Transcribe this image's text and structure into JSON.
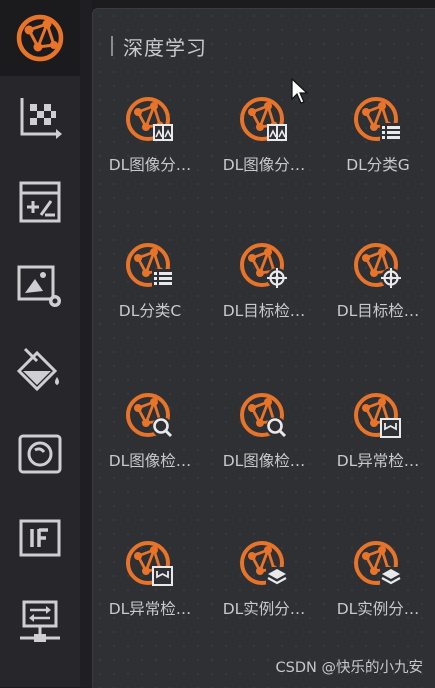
{
  "rail": {
    "items": [
      {
        "name": "deep-learning-icon",
        "active": true
      },
      {
        "name": "scatter-matrix-icon",
        "active": false
      },
      {
        "name": "calculator-icon",
        "active": false
      },
      {
        "name": "image-settings-icon",
        "active": false
      },
      {
        "name": "paint-bucket-icon",
        "active": false
      },
      {
        "name": "camera-icon",
        "active": false
      },
      {
        "name": "if-condition-icon",
        "active": false
      },
      {
        "name": "network-switch-icon",
        "active": false
      }
    ]
  },
  "panel": {
    "title": "深度学习",
    "tiles": [
      {
        "label": "DL图像分…",
        "badge": "image-icon"
      },
      {
        "label": "DL图像分…",
        "badge": "image-icon"
      },
      {
        "label": "DL分类G",
        "badge": "list-icon"
      },
      {
        "label": "DL分类C",
        "badge": "list-icon"
      },
      {
        "label": "DL目标检…",
        "badge": "target-icon"
      },
      {
        "label": "DL目标检…",
        "badge": "target-icon"
      },
      {
        "label": "DL图像检…",
        "badge": "search-icon"
      },
      {
        "label": "DL图像检…",
        "badge": "search-icon"
      },
      {
        "label": "DL异常检…",
        "badge": "anomaly-icon"
      },
      {
        "label": "DL异常检…",
        "badge": "anomaly-icon"
      },
      {
        "label": "DL实例分…",
        "badge": "layers-icon"
      },
      {
        "label": "DL实例分…",
        "badge": "layers-icon"
      }
    ]
  },
  "watermark": "CSDN @快乐的小九安",
  "colors": {
    "accent": "#e8742a",
    "icon": "#cfcfd2"
  }
}
